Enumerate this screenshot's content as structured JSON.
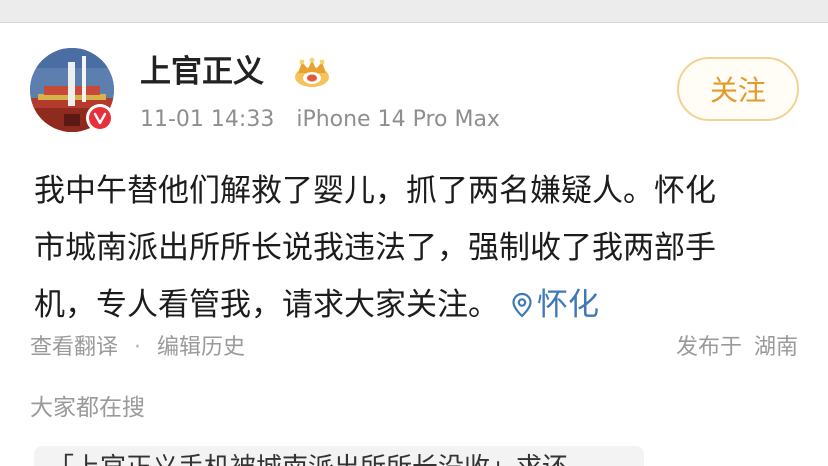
{
  "post": {
    "username": "上官正义",
    "timestamp": "11-01 14:33",
    "device": "iPhone 14 Pro Max",
    "follow_label": "关注",
    "content_lines": [
      "我中午替他们解救了婴儿，抓了两名嫌疑人。怀化",
      "市城南派出所所长说我违法了，强制收了我两部手",
      "机，专人看管我，请求大家关注。"
    ],
    "location": "怀化",
    "translate_label": "查看翻译",
    "separator": "·",
    "edit_history_label": "编辑历史",
    "published_prefix": "发布于",
    "published_place": "湖南"
  },
  "search": {
    "title": "大家都在搜",
    "first_item": "「上官正义手机被城南派出所所长没收」求还"
  },
  "colors": {
    "follow_text": "#e29b2a",
    "follow_border": "#f2d293",
    "location": "#3f78b8",
    "verified_badge": "#e8303a",
    "muted_text": "#9a9a9a"
  },
  "icons": {
    "verified": "verified-v-badge-icon",
    "crown": "gold-member-crown-icon",
    "location": "location-pin-icon"
  }
}
